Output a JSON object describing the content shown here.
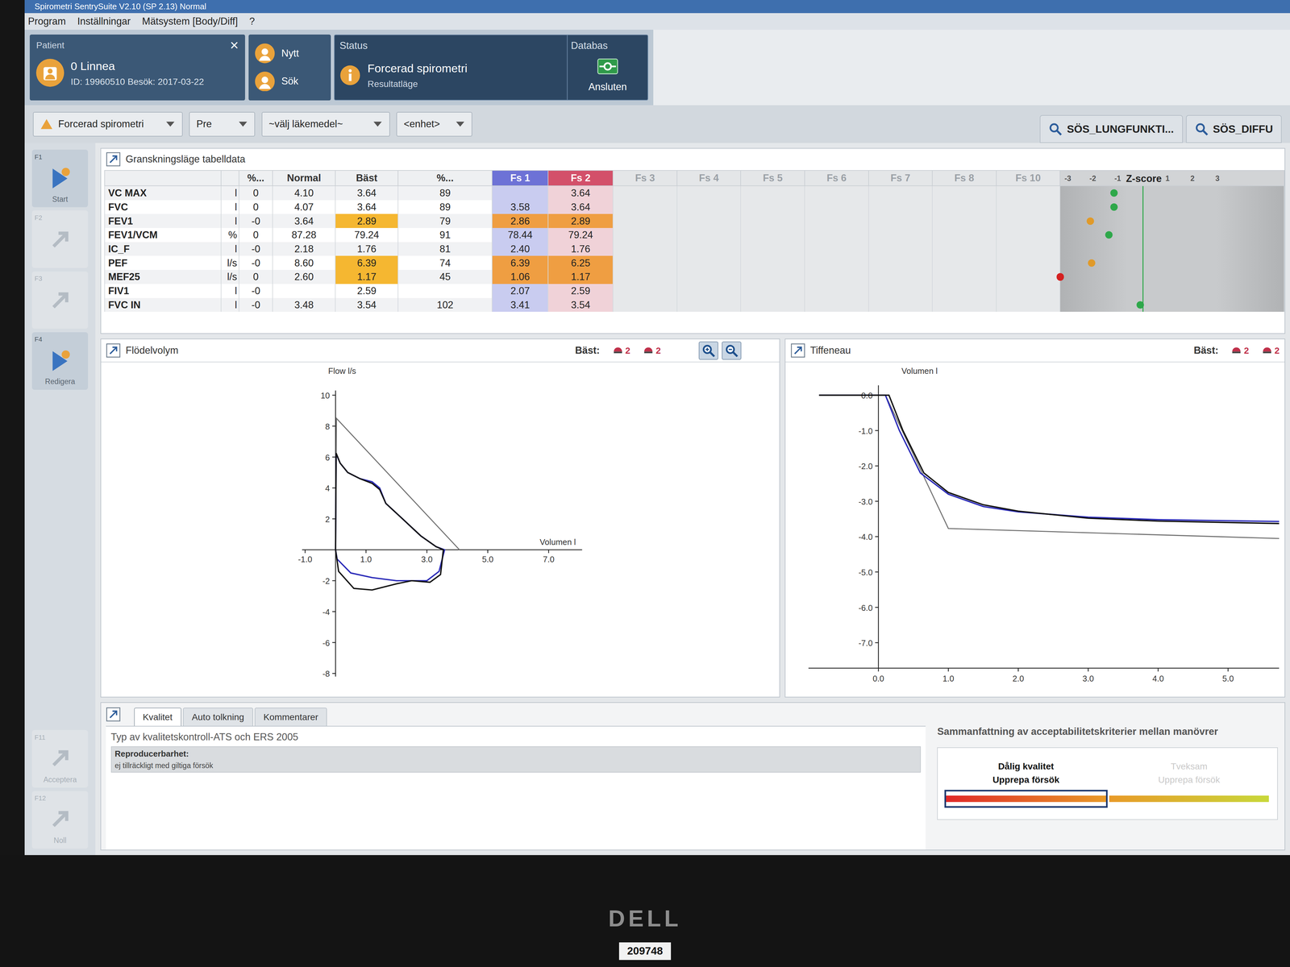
{
  "window": {
    "title": "Spirometri  SentrySuite  V2.10 (SP 2.13) Normal"
  },
  "menu": [
    {
      "label": "Program"
    },
    {
      "label": "Inställningar"
    },
    {
      "label": "Mätsystem [Body/Diff]"
    },
    {
      "label": "?"
    }
  ],
  "patient": {
    "label": "Patient",
    "name": "0 Linnea",
    "id": "ID: 19960510 Besök: 2017-03-22",
    "close": "×"
  },
  "patient_buttons": [
    {
      "label": "Nytt"
    },
    {
      "label": "Sök"
    }
  ],
  "status": {
    "label": "Status",
    "title": "Forcerad spirometri",
    "subtitle": "Resultatläge"
  },
  "database": {
    "label": "Databas",
    "value": "Ansluten"
  },
  "toolbar": {
    "dropdowns": [
      {
        "label": "Forcerad spirometri"
      },
      {
        "label": "Pre"
      },
      {
        "label": "~välj läkemedel~"
      },
      {
        "label": "<enhet>"
      }
    ],
    "tabs": [
      {
        "label": "SÖS_LUNGFUNKTI..."
      },
      {
        "label": "SÖS_DIFFU"
      }
    ]
  },
  "sidebar": {
    "items": [
      {
        "key": "F1",
        "label": "Start",
        "disabled": false
      },
      {
        "key": "F2",
        "label": "",
        "disabled": true
      },
      {
        "key": "F3",
        "label": "",
        "disabled": true
      },
      {
        "key": "F4",
        "label": "Redigera",
        "disabled": false
      }
    ],
    "bottom": [
      {
        "key": "F11",
        "label": "Acceptera",
        "disabled": true
      },
      {
        "key": "F12",
        "label": "Noll",
        "disabled": true
      }
    ]
  },
  "table": {
    "title": "Granskningsläge tabelldata",
    "columns": [
      {
        "label": "",
        "selected": false
      },
      {
        "label": "",
        "selected": false
      },
      {
        "label": "%...",
        "selected": false
      },
      {
        "label": "Normal",
        "selected": false
      },
      {
        "label": "Bäst",
        "selected": false
      },
      {
        "label": "%...",
        "selected": false
      },
      {
        "label": "Fs 1",
        "selected": true,
        "color": "#6d72d6"
      },
      {
        "label": "Fs 2",
        "selected": true,
        "color": "#d3506a"
      },
      {
        "label": "Fs 3",
        "selected": false
      },
      {
        "label": "Fs 4",
        "selected": false
      },
      {
        "label": "Fs 5",
        "selected": false
      },
      {
        "label": "Fs 6",
        "selected": false
      },
      {
        "label": "Fs 7",
        "selected": false
      },
      {
        "label": "Fs 8",
        "selected": false
      },
      {
        "label": "Fs 10",
        "selected": false
      }
    ],
    "zscore": {
      "title": "Z-score",
      "ticks": [
        "-3",
        "-2",
        "-1",
        "1",
        "2",
        "3"
      ]
    },
    "rows": [
      {
        "cells": [
          "VC MAX",
          "l",
          "0",
          "4.10",
          "3.64",
          "89",
          "",
          "3.64"
        ],
        "flags": [
          false,
          false,
          false,
          false,
          false,
          false,
          false,
          false
        ],
        "z": -1.15,
        "color": "#2ea84a"
      },
      {
        "cells": [
          "FVC",
          "l",
          "0",
          "4.07",
          "3.64",
          "89",
          "3.58",
          "3.64"
        ],
        "flags": [
          false,
          false,
          false,
          false,
          false,
          false,
          false,
          false
        ],
        "z": -1.15,
        "color": "#2ea84a"
      },
      {
        "cells": [
          "FEV1",
          "l",
          "-0",
          "3.64",
          "2.89",
          "79",
          "2.86",
          "2.89"
        ],
        "flags": [
          false,
          false,
          false,
          false,
          true,
          false,
          true,
          true
        ],
        "z": -2.1,
        "color": "#e09a2a"
      },
      {
        "cells": [
          "FEV1/VCM",
          "%",
          "0",
          "87.28",
          "79.24",
          "91",
          "78.44",
          "79.24"
        ],
        "flags": [
          false,
          false,
          false,
          false,
          false,
          false,
          false,
          false
        ],
        "z": -1.35,
        "color": "#2ea84a"
      },
      {
        "cells": [
          "IC_F",
          "l",
          "-0",
          "2.18",
          "1.76",
          "81",
          "2.40",
          "1.76"
        ],
        "flags": [
          false,
          false,
          false,
          false,
          false,
          false,
          false,
          false
        ],
        "z": null,
        "color": "#2ea84a"
      },
      {
        "cells": [
          "PEF",
          "l/s",
          "-0",
          "8.60",
          "6.39",
          "74",
          "6.39",
          "6.25"
        ],
        "flags": [
          false,
          false,
          false,
          false,
          true,
          false,
          true,
          true
        ],
        "z": -2.05,
        "color": "#e09a2a"
      },
      {
        "cells": [
          "MEF25",
          "l/s",
          "0",
          "2.60",
          "1.17",
          "45",
          "1.06",
          "1.17"
        ],
        "flags": [
          false,
          false,
          false,
          false,
          true,
          false,
          true,
          true
        ],
        "z": -3.3,
        "color": "#d42020"
      },
      {
        "cells": [
          "FIV1",
          "l",
          "-0",
          "",
          "2.59",
          "",
          "2.07",
          "2.59"
        ],
        "flags": [
          false,
          false,
          false,
          false,
          false,
          false,
          false,
          false
        ],
        "z": null,
        "color": "#2ea84a"
      },
      {
        "cells": [
          "FVC IN",
          "l",
          "-0",
          "3.48",
          "3.54",
          "102",
          "3.41",
          "3.54"
        ],
        "flags": [
          false,
          false,
          false,
          false,
          false,
          false,
          false,
          false
        ],
        "z": -0.1,
        "color": "#2ea84a"
      }
    ]
  },
  "flow_volume": {
    "title": "Flödelvolym",
    "legend_label": "Bäst:",
    "legend": [
      {
        "label": "2"
      },
      {
        "label": "2"
      }
    ],
    "y_title": "Flow l/s",
    "x_title": "Volumen l",
    "x_ticks": [
      "-1.0",
      "1.0",
      "3.0",
      "5.0",
      "7.0"
    ],
    "y_ticks": [
      "10",
      "8",
      "6",
      "4",
      "2",
      "-2",
      "-4",
      "-6",
      "-8"
    ],
    "series": [
      {
        "name": "Normal",
        "color": "#707070",
        "volume": [
          0,
          0.03,
          4.07
        ],
        "flow": [
          0,
          8.5,
          0
        ]
      },
      {
        "name": "Fs 1",
        "color": "#2a2ab8",
        "volume": [
          0,
          0.02,
          0.15,
          0.4,
          0.8,
          1.2,
          1.45,
          1.65,
          2.2,
          2.8,
          3.3,
          3.58,
          3.4,
          3.0,
          2.5,
          2.0,
          1.2,
          0.5,
          0.05,
          0
        ],
        "flow": [
          0,
          6.2,
          5.6,
          5.0,
          4.6,
          4.4,
          4.0,
          3.0,
          2.0,
          0.9,
          0.2,
          0,
          -1.4,
          -2.0,
          -2.0,
          -2.0,
          -1.8,
          -1.5,
          -0.6,
          0
        ]
      },
      {
        "name": "Fs 2",
        "color": "#111111",
        "volume": [
          0,
          0.02,
          0.15,
          0.4,
          0.8,
          1.2,
          1.45,
          1.65,
          2.2,
          2.8,
          3.3,
          3.54,
          3.45,
          3.1,
          2.5,
          2.0,
          1.2,
          0.6,
          0.1,
          0
        ],
        "flow": [
          0,
          6.25,
          5.6,
          5.0,
          4.6,
          4.3,
          3.9,
          3.0,
          2.0,
          0.9,
          0.2,
          0,
          -1.6,
          -2.1,
          -2.0,
          -2.2,
          -2.6,
          -2.5,
          -1.4,
          0
        ]
      }
    ]
  },
  "tiffeneau": {
    "title": "Tiffeneau",
    "legend_label": "Bäst:",
    "legend": [
      {
        "label": "2"
      },
      {
        "label": "2"
      }
    ],
    "y_title": "Volumen l",
    "x_ticks": [
      "0.0",
      "1.0",
      "2.0",
      "3.0",
      "4.0",
      "5.0"
    ],
    "y_ticks": [
      "0.0",
      "-1.0",
      "-2.0",
      "-3.0",
      "-4.0",
      "-5.0",
      "-6.0",
      "-7.0"
    ],
    "series": [
      {
        "name": "Normal",
        "color": "#707070",
        "time": [
          -0.2,
          0.1,
          1.0,
          6.0
        ],
        "volume": [
          0,
          0,
          -3.77,
          -4.07
        ]
      },
      {
        "name": "Fs 1",
        "color": "#2a2ab8",
        "time": [
          -0.85,
          0.1,
          0.3,
          0.6,
          1.0,
          1.5,
          2.0,
          3.0,
          4.0,
          6.0
        ],
        "volume": [
          0,
          0,
          -1.0,
          -2.2,
          -2.8,
          -3.15,
          -3.3,
          -3.45,
          -3.52,
          -3.58
        ]
      },
      {
        "name": "Fs 2",
        "color": "#111111",
        "time": [
          -0.85,
          0.15,
          0.35,
          0.65,
          1.0,
          1.5,
          2.0,
          3.0,
          4.0,
          6.0
        ],
        "volume": [
          0,
          0,
          -1.0,
          -2.2,
          -2.75,
          -3.1,
          -3.28,
          -3.48,
          -3.56,
          -3.64
        ]
      }
    ]
  },
  "quality": {
    "tabs": [
      {
        "label": "Kvalitet",
        "selected": true
      },
      {
        "label": "Auto tolkning",
        "selected": false
      },
      {
        "label": "Kommentarer",
        "selected": false
      }
    ],
    "type": "Typ av kvalitetskontroll-ATS och ERS 2005",
    "reproducibility_label": "Reproducerbarhet:",
    "reproducibility_value": "ej tillräckligt med giltiga försök",
    "summary_title": "Sammanfattning av acceptabilitetskriterier mellan manövrer",
    "segments": [
      {
        "title": "Dålig kvalitet",
        "subtitle": "Upprepa försök",
        "selected": true,
        "color": "#e02828"
      },
      {
        "title": "Tveksam",
        "subtitle": "Upprepa försök",
        "selected": false,
        "color": "#e89a28"
      }
    ]
  },
  "monitor": {
    "brand": "DELL",
    "asset_tag": "209748"
  }
}
